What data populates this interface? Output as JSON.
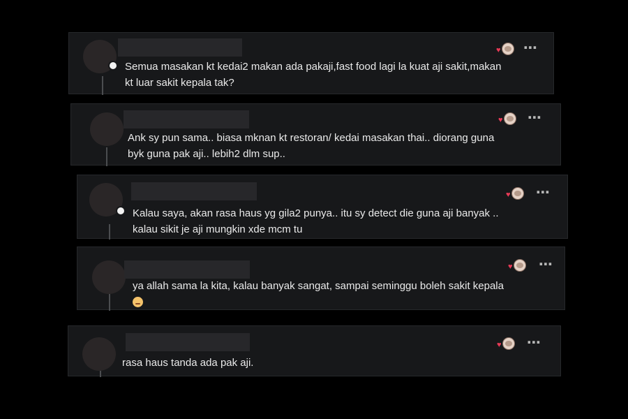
{
  "comments": [
    {
      "text": "Semua masakan kt kedai2 makan ada pakaji,fast food lagi la kuat aji sakit,makan\nkt luar sakit kepala tak?",
      "more_icon": "⋯"
    },
    {
      "text": "Ank sy pun sama.. biasa mknan kt restoran/ kedai masakan thai.. diorang guna\nbyk guna pak aji.. lebih2 dlm sup..",
      "more_icon": "⋯"
    },
    {
      "text": "Kalau saya, akan rasa haus yg gila2 punya.. itu sy detect die guna aji banyak ..\nkalau sikit je aji mungkin xde mcm tu",
      "more_icon": "⋯"
    },
    {
      "text": "ya allah sama la kita, kalau banyak sangat, sampai seminggu boleh sakit kepala",
      "more_icon": "⋯"
    },
    {
      "text": "rasa haus tanda ada pak aji.",
      "more_icon": "⋯"
    }
  ],
  "colors": {
    "background": "#000000",
    "card": "#17181a",
    "text": "#eaeaea",
    "heart": "#e83a56"
  },
  "icons": {
    "reaction": "heart-reaction-icon",
    "more": "more-options-icon",
    "emoji": "worried-face-emoji"
  }
}
